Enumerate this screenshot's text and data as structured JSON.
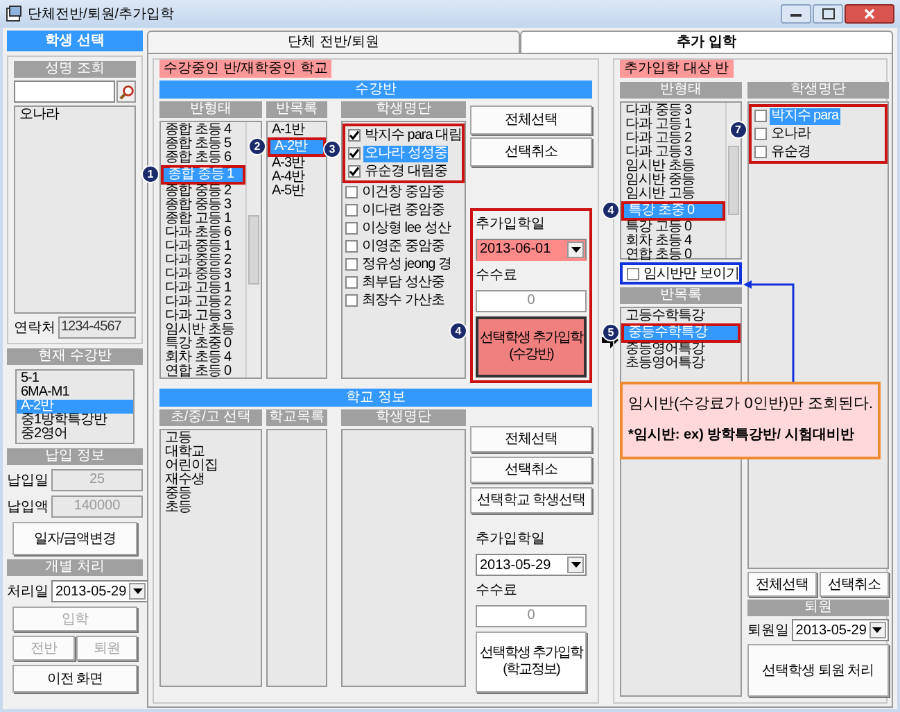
{
  "window": {
    "title": "단체전반/퇴원/추가입학"
  },
  "student_panel": {
    "header": "학생 선택",
    "search_header": "성명 조회",
    "results": [
      {
        "label": "오나라",
        "selected": false
      }
    ],
    "contact_label": "연락처",
    "contact": "1234-4567",
    "current_header": "현재 수강반",
    "current_classes": [
      {
        "label": "5-1",
        "selected": false
      },
      {
        "label": "6MA-M1",
        "selected": false
      },
      {
        "label": "A-2반",
        "selected": true
      },
      {
        "label": "중1방학특강반",
        "selected": false
      },
      {
        "label": "중2영어",
        "selected": false
      }
    ],
    "payment_header": "납입 정보",
    "paid_date_label": "납입일",
    "paid_date": "25",
    "paid_amount_label": "납입액",
    "paid_amount": "140000",
    "change_button": "일자/금액변경",
    "individual_header": "개별 처리",
    "process_date_label": "처리일",
    "process_date": "2013-05-29",
    "buttons": [
      {
        "label": "입학",
        "disabled": true
      },
      {
        "label": "전반",
        "disabled": true
      },
      {
        "label": "퇴원",
        "disabled": true
      },
      {
        "label": "이전 화면",
        "disabled": false
      }
    ]
  },
  "tabs": [
    {
      "label": "단체 전반/퇴원",
      "selected": false
    },
    {
      "label": "추가 입학",
      "selected": true
    }
  ],
  "current_group": {
    "legend": "수강중인 반/재학중인 학교",
    "class_section": {
      "header": "수강반",
      "columns": [
        "반형태",
        "반목록",
        "학생명단"
      ],
      "class_types": [
        {
          "label": "종합 초등 4",
          "selected": false
        },
        {
          "label": "종합 초등 5",
          "selected": false
        },
        {
          "label": "종합 초등 6",
          "selected": false
        },
        {
          "label": "종합 중등 1",
          "selected": true,
          "marker": "1"
        },
        {
          "label": "종합 중등 2",
          "selected": false
        },
        {
          "label": "종합 중등 3",
          "selected": false
        },
        {
          "label": "종합 고등 1",
          "selected": false
        },
        {
          "label": "다과 초등 6",
          "selected": false
        },
        {
          "label": "다과 중등 1",
          "selected": false
        },
        {
          "label": "다과 중등 2",
          "selected": false
        },
        {
          "label": "다과 중등 3",
          "selected": false
        },
        {
          "label": "다과 고등 1",
          "selected": false
        },
        {
          "label": "다과 고등 2",
          "selected": false
        },
        {
          "label": "다과 고등 3",
          "selected": false
        },
        {
          "label": "임시반 초등",
          "selected": false
        },
        {
          "label": "특강 초중 0",
          "selected": false
        },
        {
          "label": "회차 초등 4",
          "selected": false
        },
        {
          "label": "연합 초등 0",
          "selected": false
        }
      ],
      "classes": [
        {
          "label": "A-1반",
          "selected": false
        },
        {
          "label": "A-2반",
          "selected": true,
          "marker": "2"
        },
        {
          "label": "A-3반",
          "selected": false
        },
        {
          "label": "A-4반",
          "selected": false
        },
        {
          "label": "A-5반",
          "selected": false
        }
      ],
      "students_marker": "3",
      "students": [
        {
          "label": "박지수 para 대림",
          "checked": true,
          "selected": false,
          "highlighted": true
        },
        {
          "label": "오나라 성성중",
          "checked": true,
          "selected": true,
          "highlighted": true
        },
        {
          "label": "유순경 대림중",
          "checked": true,
          "selected": false,
          "highlighted": true
        },
        {
          "label": "이건창 중암중",
          "checked": false,
          "selected": false,
          "highlighted": false
        },
        {
          "label": "이다련 중암중",
          "checked": false,
          "selected": false,
          "highlighted": false
        },
        {
          "label": "이상형 lee 성산",
          "checked": false,
          "selected": false,
          "highlighted": false
        },
        {
          "label": "이영준 중암중",
          "checked": false,
          "selected": false,
          "highlighted": false
        },
        {
          "label": "정유성 jeong 경",
          "checked": false,
          "selected": false,
          "highlighted": false
        },
        {
          "label": "최부담 성산중",
          "checked": false,
          "selected": false,
          "highlighted": false
        },
        {
          "label": "최장수 가산초",
          "checked": false,
          "selected": false,
          "highlighted": false
        }
      ],
      "buttons": [
        "전체선택",
        "선택취소"
      ],
      "add": {
        "highlighted": true,
        "marker": "4",
        "date_label": "추가입학일",
        "date": "2013-06-01",
        "fee_label": "수수료",
        "fee": "0",
        "button": "선택학생 추가입학\n(수강반)"
      }
    },
    "school_section": {
      "header": "학교 정보",
      "columns": [
        "초/중/고 선택",
        "학교목록",
        "학생명단"
      ],
      "levels": [
        {
          "label": "고등",
          "selected": false
        },
        {
          "label": "대학교",
          "selected": false
        },
        {
          "label": "어린이집",
          "selected": false
        },
        {
          "label": "재수생",
          "selected": false
        },
        {
          "label": "중등",
          "selected": false
        },
        {
          "label": "초등",
          "selected": false
        }
      ],
      "buttons": [
        "전체선택",
        "선택취소",
        "선택학교 학생선택"
      ],
      "add": {
        "highlighted": false,
        "date_label": "추가입학일",
        "date": "2013-05-29",
        "fee_label": "수수료",
        "fee": "0",
        "button": "선택학생 추가입학\n(학교정보)"
      }
    }
  },
  "add_group": {
    "legend": "추가입학 대상 반",
    "columns": [
      "반형태",
      "학생명단",
      "반목록"
    ],
    "class_types": [
      {
        "label": "다과 중등 3",
        "selected": false
      },
      {
        "label": "다과 고등 1",
        "selected": false
      },
      {
        "label": "다과 고등 2",
        "selected": false
      },
      {
        "label": "다과 고등 3",
        "selected": false
      },
      {
        "label": "임시반 초등",
        "selected": false
      },
      {
        "label": "임시반 중등",
        "selected": false
      },
      {
        "label": "임시반 고등",
        "selected": false
      },
      {
        "label": "특강 초중 0",
        "selected": true,
        "marker": "4"
      },
      {
        "label": "특강 고등 0",
        "selected": false
      },
      {
        "label": "회차 초등 4",
        "selected": false
      },
      {
        "label": "연합 초등 0",
        "selected": false
      }
    ],
    "temp_only": {
      "label": "임시반만 보이기",
      "checked": false
    },
    "classes": [
      {
        "label": "고등수학특강",
        "selected": false
      },
      {
        "label": "중등수학특강",
        "selected": true,
        "marker": "5"
      },
      {
        "label": "중등영어특강",
        "selected": false
      },
      {
        "label": "초등영어특강",
        "selected": false
      }
    ],
    "students_marker": "7",
    "students": [
      {
        "label": "박지수 para",
        "checked": false,
        "selected": true,
        "highlighted": true
      },
      {
        "label": "오나라",
        "checked": false,
        "selected": false,
        "highlighted": true
      },
      {
        "label": "유순경",
        "checked": false,
        "selected": false,
        "highlighted": true
      }
    ],
    "buttons": [
      "전체선택",
      "선택취소"
    ],
    "withdraw_header": "퇴원",
    "withdraw_date_label": "퇴원일",
    "withdraw_date": "2013-05-29",
    "withdraw_button": "선택학생 퇴원 처리"
  },
  "callout": {
    "title": "임시반(수강료가 0인반)만 조회된다.",
    "note": "*임시반: ex) 방학특강반/ 시험대비반"
  }
}
